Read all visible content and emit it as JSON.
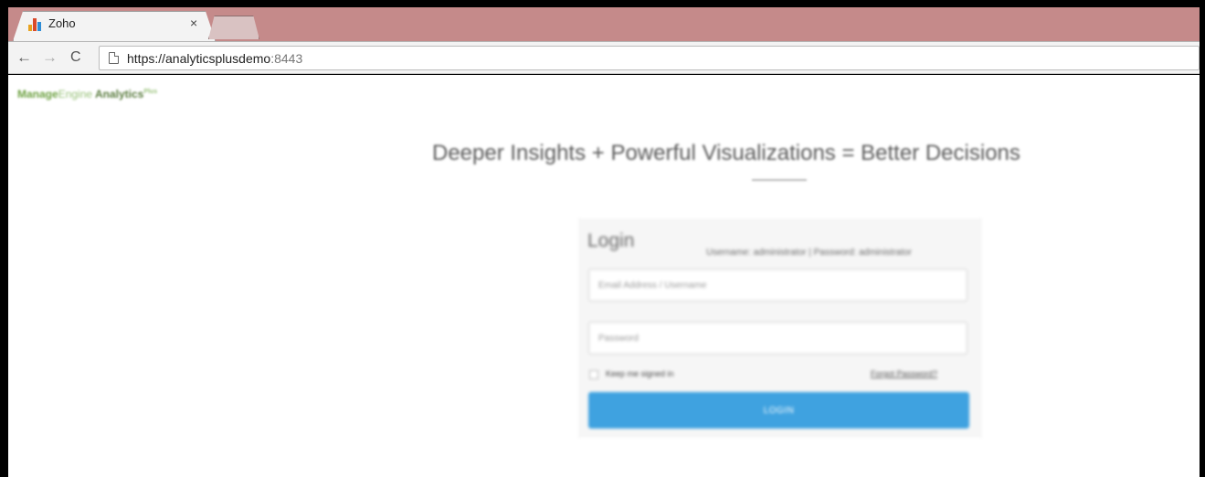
{
  "browser": {
    "tab_title": "Zoho",
    "tab_close": "×",
    "url_host": "https://analyticsplusdemo",
    "url_port": ":8443"
  },
  "nav": {
    "back": "←",
    "forward": "→",
    "reload": "C"
  },
  "page": {
    "logo": {
      "part1": "Manage",
      "part2": "Engine",
      "part3": " Analytics",
      "sup": "Plus"
    },
    "headline": "Deeper Insights + Powerful Visualizations = Better Decisions",
    "login": {
      "title": "Login",
      "hint": "Username: administrator | Password: administrator",
      "email_placeholder": "Email Address / Username",
      "password_placeholder": "Password",
      "keep_signed_in": "Keep me signed in",
      "forgot_password": "Forgot Password?",
      "button": "LOGIN"
    }
  },
  "colors": {
    "tabstrip": "#c58a8a",
    "login_button": "#3fa2e0",
    "logo_green": "#6fa244"
  }
}
